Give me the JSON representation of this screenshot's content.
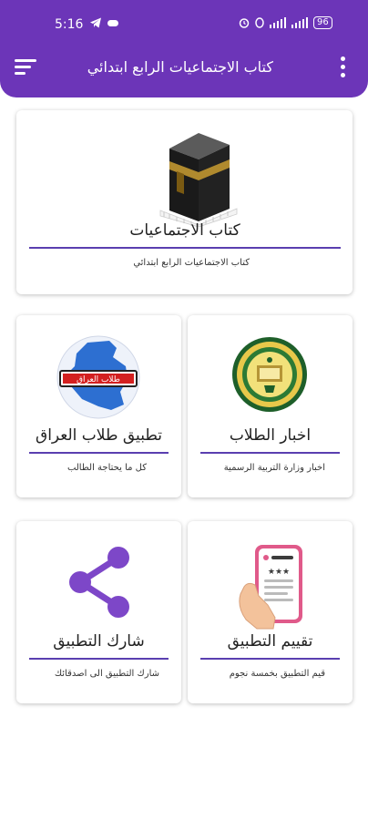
{
  "status": {
    "time": "5:16",
    "battery": "96"
  },
  "header": {
    "title": "كتاب الاجتماعيات الرابع ابتدائي",
    "bg": "#6c35b8"
  },
  "cards": {
    "book": {
      "title": "كتاب الاجتماعيات",
      "subtitle": "كتاب الاجتماعيات الرابع ابتدائي",
      "icon": "kaaba-icon"
    },
    "news": {
      "title": "اخبار الطلاب",
      "subtitle": "اخبار وزارة التربية الرسمية",
      "icon": "ministry-seal-icon"
    },
    "app": {
      "title": "تطبيق طلاب العراق",
      "subtitle": "كل ما يحتاجة الطالب",
      "icon": "iraq-map-icon",
      "logo_text": "طلاب العراق"
    },
    "rate": {
      "title": "تقييم التطبيق",
      "subtitle": "قيم التطبيق بخمسة نجوم",
      "icon": "phone-rating-icon"
    },
    "share": {
      "title": "شارك التطبيق",
      "subtitle": "شارك التطبيق الى اصدقائك",
      "icon": "share-icon"
    }
  },
  "accent": "#5a3fb0"
}
